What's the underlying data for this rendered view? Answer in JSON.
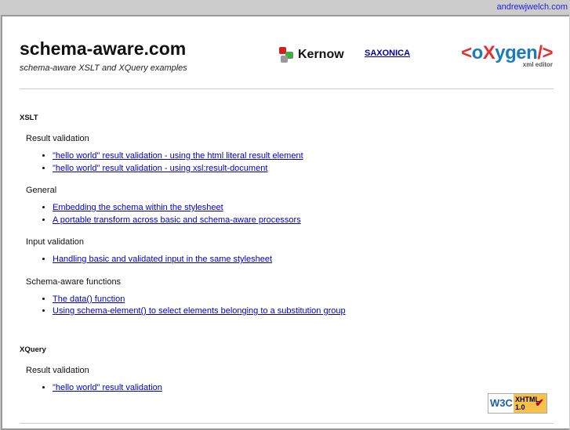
{
  "topbar": {
    "link": "andrewjwelch.com"
  },
  "header": {
    "title": "schema-aware.com",
    "subtitle": "schema-aware XSLT and XQuery examples",
    "kernow": "Kernow",
    "saxonica": "SAXONICA",
    "oxygen_logo": "<oXygen/>",
    "oxygen_sub": "xml editor"
  },
  "sections": [
    {
      "heading": "XSLT",
      "groups": [
        {
          "title": "Result validation",
          "links": [
            "\"hello world\" result validation - using the html literal result element",
            "\"hello world\" result validation - using xsl:result-document"
          ]
        },
        {
          "title": "General",
          "links": [
            "Embedding the schema within the stylesheet",
            "A portable transform across basic and schema-aware processors"
          ]
        },
        {
          "title": "Input validation",
          "links": [
            "Handling basic and validated input in the same stylesheet"
          ]
        },
        {
          "title": "Schema-aware functions",
          "links": [
            "The data() function",
            "Using schema-element() to select elements belonging to a substitution group"
          ]
        }
      ]
    },
    {
      "heading": "XQuery",
      "groups": [
        {
          "title": "Result validation",
          "links": [
            "\"hello world\" result validation"
          ]
        }
      ]
    }
  ],
  "badge": {
    "w3c": "W3C",
    "xhtml": "XHTML",
    "version": "1.0"
  }
}
